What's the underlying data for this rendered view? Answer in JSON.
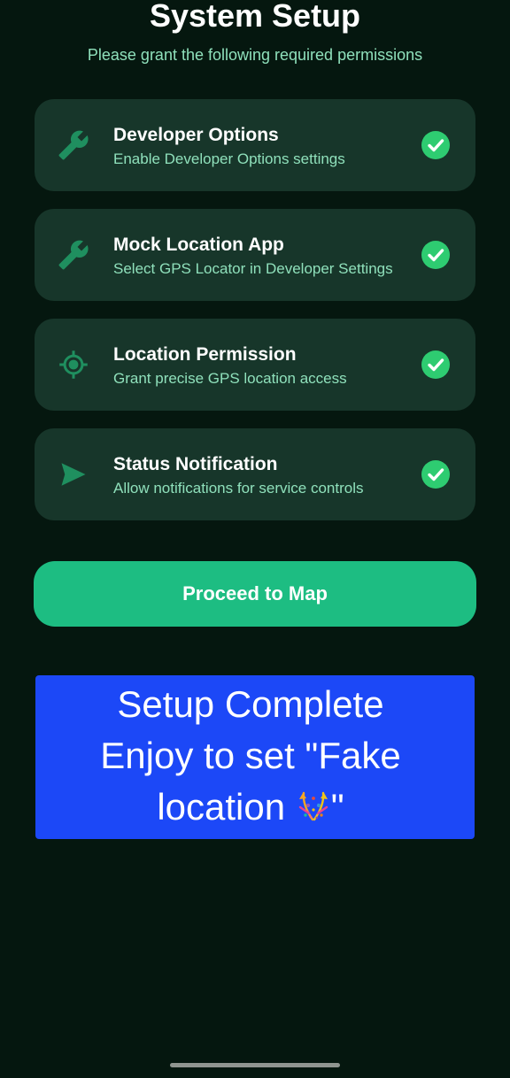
{
  "header": {
    "title": "System Setup",
    "subtitle": "Please grant the following required permissions"
  },
  "permissions": [
    {
      "title": "Developer Options",
      "description": "Enable Developer Options settings",
      "icon": "wrench-icon",
      "granted": true
    },
    {
      "title": "Mock Location App",
      "description": "Select GPS Locator in Developer Settings",
      "icon": "wrench-icon",
      "granted": true
    },
    {
      "title": "Location Permission",
      "description": "Grant precise GPS location access",
      "icon": "location-crosshair-icon",
      "granted": true
    },
    {
      "title": "Status Notification",
      "description": "Allow notifications for service controls",
      "icon": "send-arrow-icon",
      "granted": true
    }
  ],
  "actions": {
    "proceed_label": "Proceed to Map"
  },
  "banner": {
    "line1": "Setup Complete",
    "line2": "Enjoy to set \"Fake",
    "line3_text": "location ",
    "line3_end": "\"",
    "emoji_icon": "party-confetti-icon"
  },
  "colors": {
    "background": "#05170f",
    "card": "#17362a",
    "accent": "#1dbd82",
    "check": "#2ecc71",
    "subtitle_text": "#8fe0bb",
    "banner": "#1c48f7"
  }
}
